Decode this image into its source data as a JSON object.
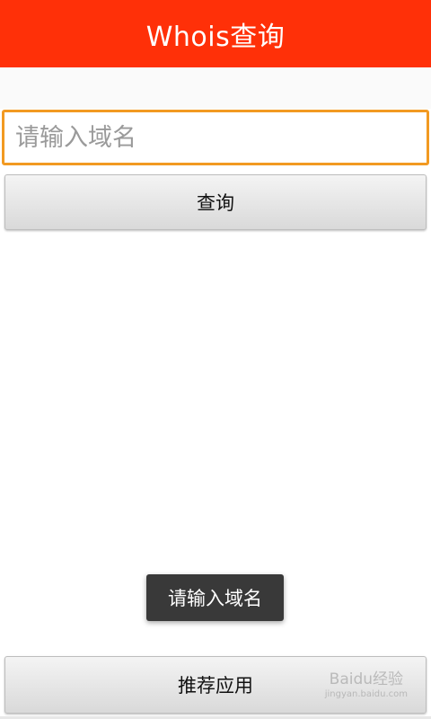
{
  "app": {
    "title": "Whois查询"
  },
  "search": {
    "placeholder": "请输入域名",
    "value": ""
  },
  "buttons": {
    "query_label": "查询",
    "recommend_label": "推荐应用"
  },
  "toast": {
    "message": "请输入域名"
  },
  "watermark": {
    "text": "Baidu经验",
    "sub": "jingyan.baidu.com"
  },
  "colors": {
    "titlebar": "#ff3008",
    "input_border": "#f29a22",
    "toast_bg": "#393939"
  }
}
